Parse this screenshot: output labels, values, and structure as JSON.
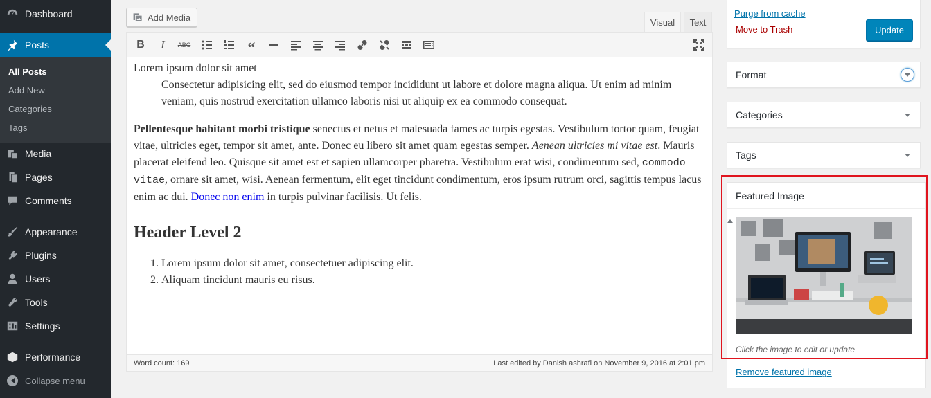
{
  "sidebar": {
    "items": [
      {
        "label": "Dashboard",
        "icon": "dashboard-icon"
      },
      {
        "label": "Posts",
        "icon": "pin-icon",
        "current": true
      },
      {
        "label": "Media",
        "icon": "media-icon"
      },
      {
        "label": "Pages",
        "icon": "pages-icon"
      },
      {
        "label": "Comments",
        "icon": "comments-icon"
      },
      {
        "label": "Appearance",
        "icon": "brush-icon"
      },
      {
        "label": "Plugins",
        "icon": "plugin-icon"
      },
      {
        "label": "Users",
        "icon": "users-icon"
      },
      {
        "label": "Tools",
        "icon": "wrench-icon"
      },
      {
        "label": "Settings",
        "icon": "settings-icon"
      },
      {
        "label": "Performance",
        "icon": "performance-icon"
      }
    ],
    "submenu": [
      "All Posts",
      "Add New",
      "Categories",
      "Tags"
    ],
    "collapse_label": "Collapse menu"
  },
  "editor": {
    "add_media_label": "Add Media",
    "tabs": {
      "visual": "Visual",
      "text": "Text"
    },
    "toolbar_icons": [
      "bold-icon",
      "italic-icon",
      "strikethrough-icon",
      "bullet-list-icon",
      "numbered-list-icon",
      "blockquote-icon",
      "horizontal-line-icon",
      "align-left-icon",
      "align-center-icon",
      "align-right-icon",
      "link-icon",
      "unlink-icon",
      "read-more-icon",
      "toolbar-toggle-icon",
      "fullscreen-icon"
    ],
    "content": {
      "line1": "Lorem ipsum dolor sit amet",
      "quote": "Consectetur adipisicing elit, sed do eiusmod tempor incididunt ut labore et dolore magna aliqua. Ut enim ad minim veniam, quis nostrud exercitation ullamco laboris nisi ut aliquip ex ea commodo consequat.",
      "p_bold": "Pellentesque habitant morbi tristique",
      "p_part1": " senectus et netus et malesuada fames ac turpis egestas. Vestibulum tortor quam, feugiat vitae, ultricies eget, tempor sit amet, ante. Donec eu libero sit amet quam egestas semper. ",
      "p_italic": "Aenean ultricies mi vitae est",
      "p_part2": ". Mauris placerat eleifend leo. Quisque sit amet est et sapien ullamcorper pharetra. Vestibulum erat wisi, condimentum sed, ",
      "p_code": "commodo vitae",
      "p_part3": ", ornare sit amet, wisi. Aenean fermentum, elit eget tincidunt condimentum, eros ipsum rutrum orci, sagittis tempus lacus enim ac dui. ",
      "p_link": "Donec non enim",
      "p_part4": " in turpis pulvinar facilisis. Ut felis.",
      "heading": "Header Level 2",
      "list": [
        "Lorem ipsum dolor sit amet, consectetuer adipiscing elit.",
        "Aliquam tincidunt mauris eu risus."
      ]
    },
    "word_count": "Word count: 169",
    "last_edited": "Last edited by Danish ashrafi on November 9, 2016 at 2:01 pm"
  },
  "publish": {
    "purge_label": "Purge from cache",
    "trash_label": "Move to Trash",
    "update_label": "Update"
  },
  "boxes": {
    "format": "Format",
    "categories": "Categories",
    "tags": "Tags",
    "featured_image": "Featured Image",
    "featured_hint": "Click the image to edit or update",
    "remove_featured": "Remove featured image"
  },
  "colors": {
    "sidebar_bg": "#23282d",
    "accent": "#0073aa",
    "highlight": "#e0141e",
    "button": "#0085ba"
  }
}
